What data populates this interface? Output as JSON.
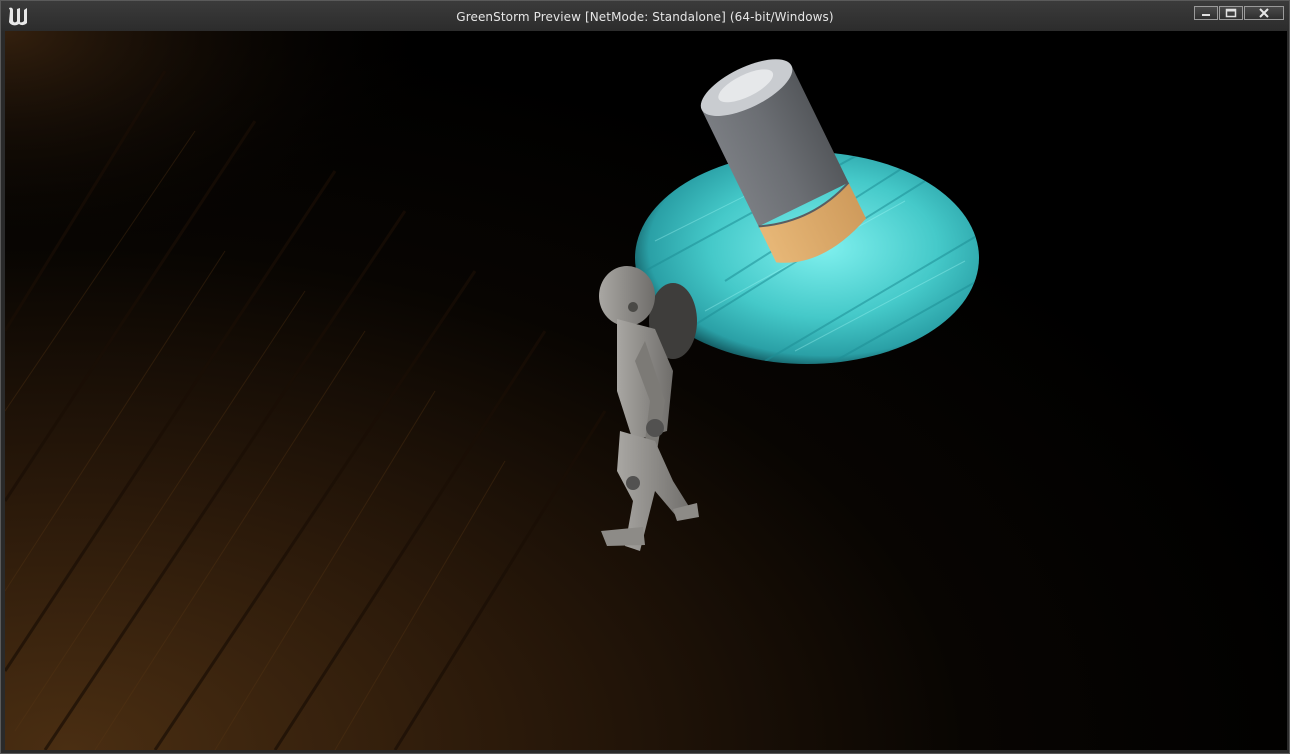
{
  "window": {
    "title": "GreenStorm Preview [NetMode: Standalone] (64-bit/Windows)",
    "logo_icon": "unreal-engine-logo-icon",
    "controls": {
      "minimize_icon": "minimize-icon",
      "maximize_icon": "maximize-icon",
      "close_icon": "close-icon"
    }
  },
  "scene": {
    "floor_color": "#3a2410",
    "spotlight_color": "#4fd6d6",
    "flashlight_body_color": "#6b6e72",
    "flashlight_cap_color": "#d9a86a",
    "character_color": "#9a9894"
  }
}
